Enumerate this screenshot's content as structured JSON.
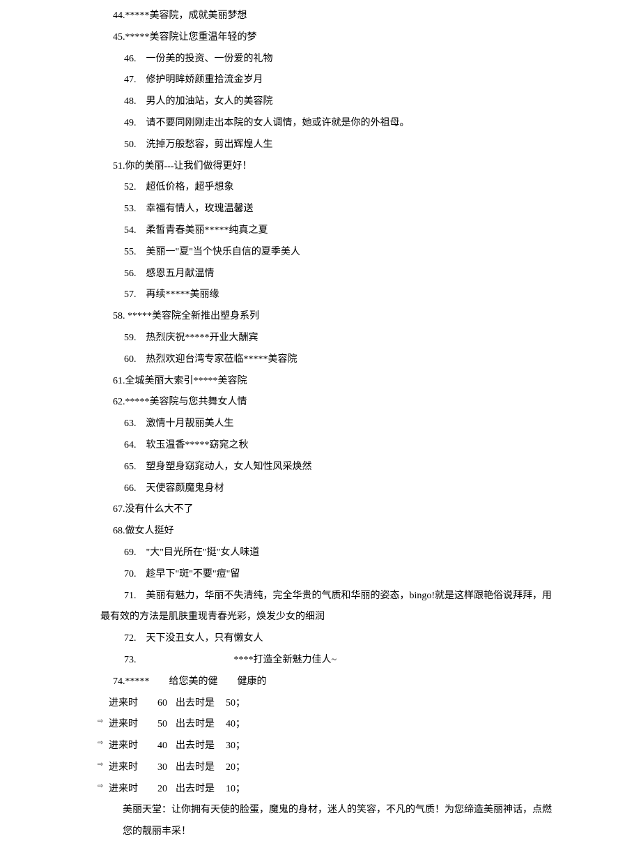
{
  "lines": [
    {
      "cls": "no-indent",
      "text": "44.*****美容院，成就美丽梦想"
    },
    {
      "cls": "no-indent",
      "text": "45.*****美容院让您重温年轻的梦"
    },
    {
      "cls": "indent",
      "text": "46.　一份美的投资、一份爱的礼物"
    },
    {
      "cls": "indent",
      "text": "47.　修护明眸娇颜重拾流金岁月"
    },
    {
      "cls": "indent",
      "text": "48.　男人的加油站，女人的美容院"
    },
    {
      "cls": "indent",
      "text": "49.　请不要同刚刚走出本院的女人调情，她或许就是你的外祖母。"
    },
    {
      "cls": "indent",
      "text": "50.　洗掉万般愁容，剪出辉煌人生"
    },
    {
      "cls": "no-indent",
      "text": "51.你的美丽---让我们做得更好！"
    },
    {
      "cls": "indent",
      "text": "52.　超低价格，超乎想象"
    },
    {
      "cls": "indent",
      "text": "53.　幸福有情人，玫瑰温馨送"
    },
    {
      "cls": "indent",
      "text": "54.　柔皙青春美丽*****纯真之夏"
    },
    {
      "cls": "indent",
      "text": "55.　美丽一\"夏\"当个快乐自信的夏季美人"
    },
    {
      "cls": "indent",
      "text": "56.　感恩五月献温情"
    },
    {
      "cls": "indent",
      "text": "57.　再续*****美丽缘"
    },
    {
      "cls": "no-indent",
      "text": "58. *****美容院全新推出塑身系列"
    },
    {
      "cls": "indent",
      "text": "59.　热烈庆祝*****开业大酬宾"
    },
    {
      "cls": "indent",
      "text": "60.　热烈欢迎台湾专家莅临*****美容院"
    },
    {
      "cls": "no-indent",
      "text": "61.全城美丽大索引*****美容院"
    },
    {
      "cls": "no-indent",
      "text": "62.*****美容院与您共舞女人情"
    },
    {
      "cls": "indent",
      "text": "63.　激情十月靓丽美人生"
    },
    {
      "cls": "indent",
      "text": "64.　软玉温香*****窈窕之秋"
    },
    {
      "cls": "indent",
      "text": "65.　塑身塑身窈窕动人，女人知性风采焕然"
    },
    {
      "cls": "indent",
      "text": "66.　天使容颜魔鬼身材"
    },
    {
      "cls": "no-indent",
      "text": "67.没有什么大不了"
    },
    {
      "cls": "no-indent",
      "text": "68.做女人挺好"
    },
    {
      "cls": "indent",
      "text": "69.　\"大\"目光所在\"挺\"女人味道"
    },
    {
      "cls": "indent",
      "text": "70.　趁早下\"斑\"不要\"痘\"留"
    },
    {
      "cls": "indent",
      "text": "71.　美丽有魅力，华丽不失清纯，完全华贵的气质和华丽的姿态，bingo!就是这样跟艳俗说拜拜，用"
    },
    {
      "cls": "sub-indent",
      "text": "最有效的方法是肌肤重现青春光彩，焕发少女的细润"
    },
    {
      "cls": "indent",
      "text": "72.　天下没丑女人，只有懒女人"
    },
    {
      "cls": "indent",
      "text": "73.　　　　　　　　　　****打造全新魅力佳人~"
    }
  ],
  "item74": "74.*****　　给您美的健　　健康的",
  "ages": [
    {
      "arrow": false,
      "label": "进来时",
      "n1": "60",
      "mid": "出去时是",
      "n2": "50；"
    },
    {
      "arrow": true,
      "label": "进来时",
      "n1": "50",
      "mid": "出去时是",
      "n2": "40；"
    },
    {
      "arrow": true,
      "label": "进来时",
      "n1": "40",
      "mid": "出去时是",
      "n2": "30；"
    },
    {
      "arrow": true,
      "label": "进来时",
      "n1": "30",
      "mid": "出去时是",
      "n2": "20；"
    },
    {
      "arrow": true,
      "label": "进来时",
      "n1": "20",
      "mid": "出去时是",
      "n2": "10；"
    }
  ],
  "final1": "美丽天堂：让你拥有天使的脸蛋，魔鬼的身材，迷人的笑容，不凡的气质！为您缔造美丽神话，点燃",
  "final2": "您的靓丽丰采！"
}
